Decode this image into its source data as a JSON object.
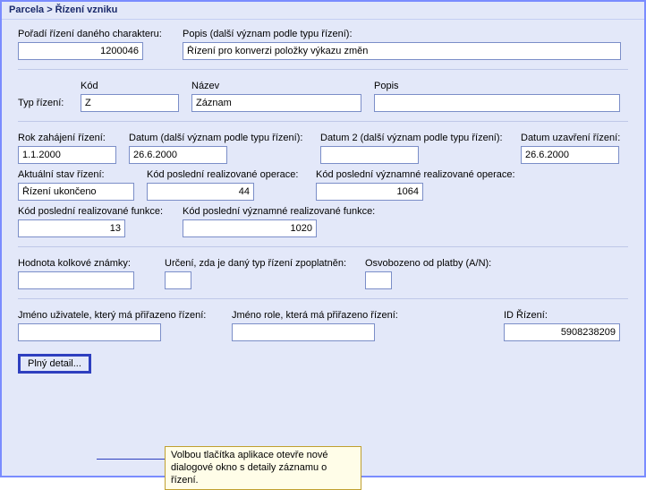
{
  "titlebar": "Parcela > Řízení vzniku",
  "f_poradi": {
    "label": "Pořadí řízení daného charakteru:",
    "value": "1200046"
  },
  "f_popis_top": {
    "label": "Popis (další význam podle typu řízení):",
    "value": "Řízení pro konverzi položky výkazu změn"
  },
  "typ_rizeni_label": "Typ řízení:",
  "f_kod": {
    "label": "Kód",
    "value": "Z"
  },
  "f_nazev": {
    "label": "Název",
    "value": "Záznam"
  },
  "f_popis2": {
    "label": "Popis",
    "value": ""
  },
  "f_rok_zahajeni": {
    "label": "Rok zahájení řízení:",
    "value": "1.1.2000"
  },
  "f_datum": {
    "label": "Datum (další význam podle typu řízení):",
    "value": "26.6.2000"
  },
  "f_datum2": {
    "label": "Datum 2 (další význam podle typu řízení):",
    "value": ""
  },
  "f_datum_uzavreni": {
    "label": "Datum uzavření řízení:",
    "value": "26.6.2000"
  },
  "f_aktualni_stav": {
    "label": "Aktuální stav řízení:",
    "value": "Řízení ukončeno"
  },
  "f_kod_posl_real_op": {
    "label": "Kód poslední realizované operace:",
    "value": "44"
  },
  "f_kod_posl_vyzn_real_op": {
    "label": "Kód poslední významné realizované operace:",
    "value": "1064"
  },
  "f_kod_posl_real_fn": {
    "label": "Kód poslední realizované funkce:",
    "value": "13"
  },
  "f_kod_posl_vyzn_real_fn": {
    "label": "Kód poslední významné realizované funkce:",
    "value": "1020"
  },
  "f_hodnota_kolkove": {
    "label": "Hodnota kolkové známky:",
    "value": ""
  },
  "f_urceni_zpoplatnen": {
    "label": "Určení, zda je daný typ řízení zpoplatněn:",
    "value": ""
  },
  "f_osvobozeno": {
    "label": "Osvobozeno od platby (A/N):",
    "value": ""
  },
  "f_jmeno_uzivatele": {
    "label": "Jméno uživatele, který má přiřazeno řízení:",
    "value": ""
  },
  "f_jmeno_role": {
    "label": "Jméno role, která má přiřazeno řízení:",
    "value": ""
  },
  "f_id_rizeni": {
    "label": "ID Řízení:",
    "value": "5908238209"
  },
  "btn_plny_detail": "Plný detail...",
  "callout_text": "Volbou tlačítka aplikace otevře nové dialogové okno s detaily záznamu o řízení."
}
